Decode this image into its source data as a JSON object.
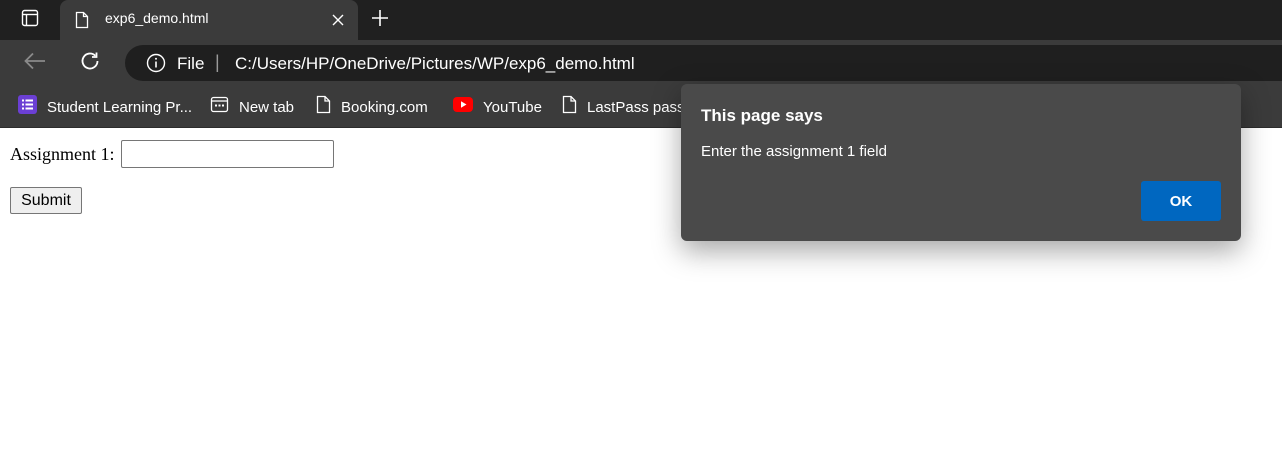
{
  "browser": {
    "tab": {
      "title": "exp6_demo.html"
    },
    "address": {
      "scheme": "File",
      "separator": "|",
      "url": "C:/Users/HP/OneDrive/Pictures/WP/exp6_demo.html"
    },
    "bookmarks": [
      {
        "label": "Student Learning Pr...",
        "icon": "list-app-icon"
      },
      {
        "label": "New tab",
        "icon": "new-tab-icon"
      },
      {
        "label": "Booking.com",
        "icon": "page-icon"
      },
      {
        "label": "YouTube",
        "icon": "youtube-icon"
      },
      {
        "label": "LastPass passw",
        "icon": "page-icon"
      }
    ]
  },
  "form": {
    "field_label": "Assignment 1:",
    "field_value": "",
    "submit_label": "Submit"
  },
  "dialog": {
    "title": "This page says",
    "message": "Enter the assignment 1 field",
    "ok_label": "OK"
  },
  "colors": {
    "accent": "#0067c0",
    "chrome_dark": "#202020",
    "chrome": "#3b3b3b",
    "youtube_red": "#ff0000",
    "app_purple": "#6b3fd4"
  }
}
